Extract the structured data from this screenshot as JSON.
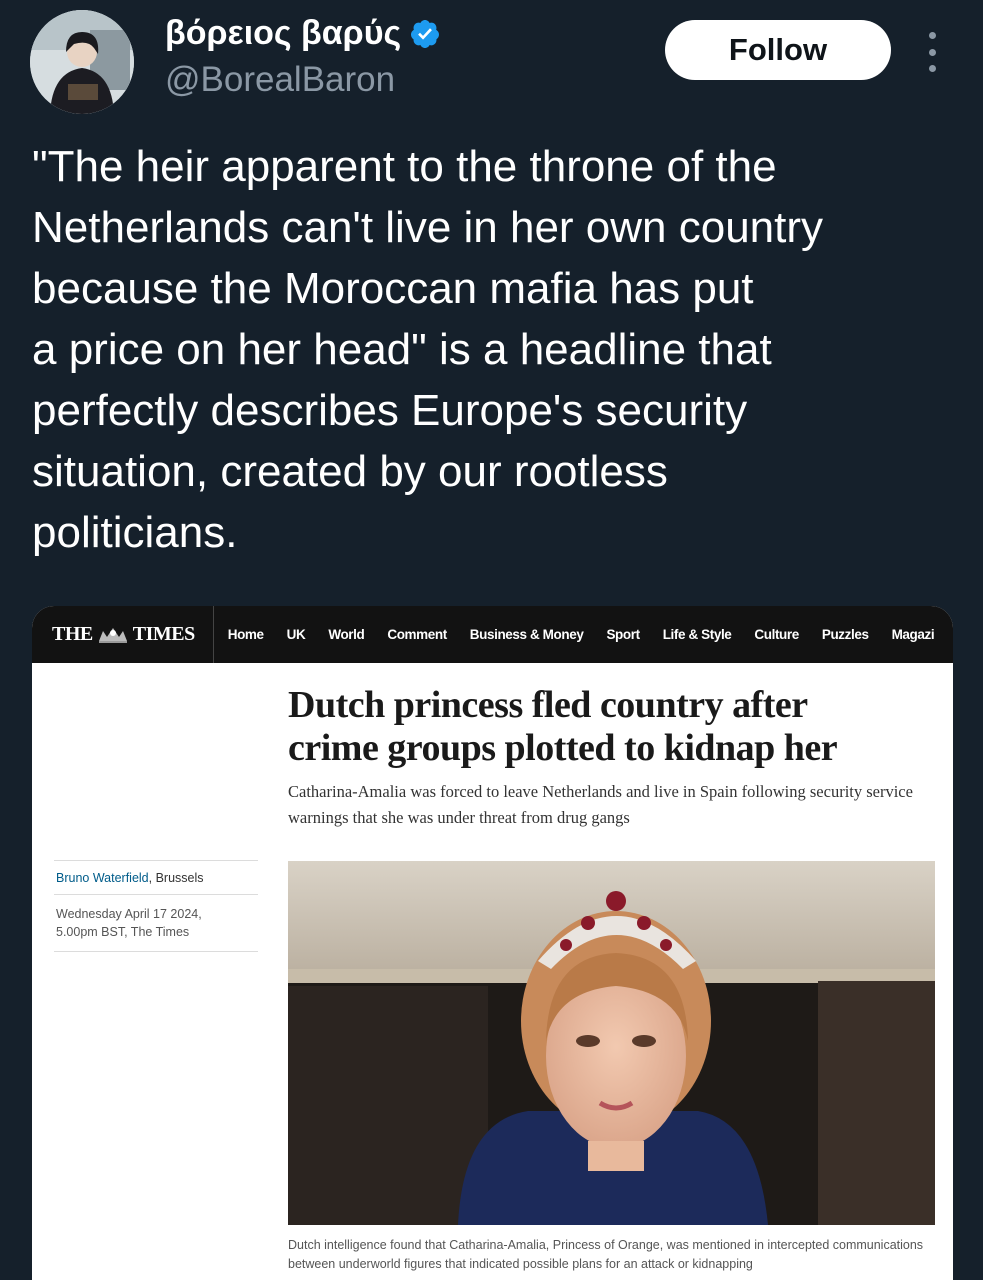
{
  "author": {
    "display_name": "βόρειος βαρύς",
    "handle": "@BorealBaron",
    "verified": true,
    "avatar_icon": "avatar-illustration"
  },
  "actions": {
    "follow_label": "Follow",
    "more_icon": "more-vertical-icon"
  },
  "tweet": {
    "text": "\"The heir apparent to the throne of the\nNetherlands can't live in her own country\nbecause the Moroccan mafia has put\na price on her head\" is a headline that\nperfectly describes Europe's security\nsituation, created by our rootless\npoliticians."
  },
  "article": {
    "logo_left": "THE",
    "logo_right": "TIMES",
    "nav": [
      "Home",
      "UK",
      "World",
      "Comment",
      "Business & Money",
      "Sport",
      "Life & Style",
      "Culture",
      "Puzzles",
      "Magazi"
    ],
    "headline": "Dutch princess fled country after\ncrime groups plotted to kidnap her",
    "standfirst": "Catharina-Amalia was forced to leave Netherlands and live in Spain following security service warnings that she was under threat from drug gangs",
    "author_name": "Bruno Waterfield",
    "author_location": ", Brussels",
    "date_line1": "Wednesday April 17 2024,",
    "date_line2": "5.00pm BST, The Times",
    "caption": "Dutch intelligence found that Catharina-Amalia, Princess of Orange, was mentioned in intercepted communications between underworld figures that indicated possible plans for an attack or kidnapping"
  },
  "colors": {
    "background": "#15202b",
    "text_primary": "#ffffff",
    "text_secondary": "#8b98a5",
    "verified_badge": "#1d9bf0",
    "times_nav": "#121212"
  }
}
